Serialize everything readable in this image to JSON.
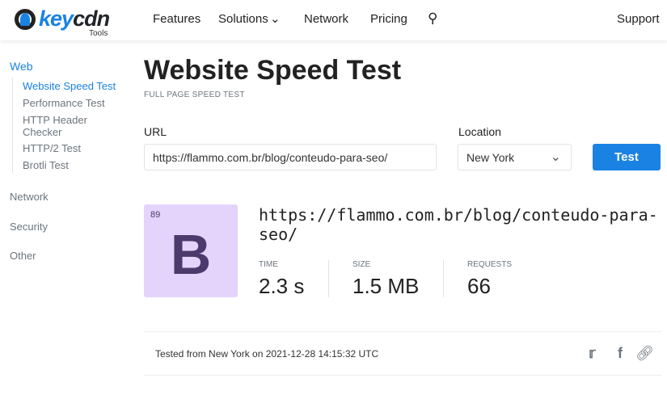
{
  "header": {
    "logo_text": "keycdn",
    "logo_sub": "Tools",
    "nav": [
      "Features",
      "Solutions",
      "Network",
      "Pricing"
    ],
    "support": "Support"
  },
  "sidebar": {
    "section": "Web",
    "items": [
      "Website Speed Test",
      "Performance Test",
      "HTTP Header Checker",
      "HTTP/2 Test",
      "Brotli Test"
    ],
    "others": [
      "Network",
      "Security",
      "Other"
    ]
  },
  "main": {
    "title": "Website Speed Test",
    "subtitle": "FULL PAGE SPEED TEST",
    "url_label": "URL",
    "url_value": "https://flammo.com.br/blog/conteudo-para-seo/",
    "location_label": "Location",
    "location_value": "New York",
    "test_button": "Test"
  },
  "result": {
    "score": "89",
    "grade": "B",
    "grade_color": "#e4d4fc",
    "url": "https://flammo.com.br/blog/conteudo-para-seo/",
    "metrics": [
      {
        "label": "TIME",
        "value": "2.3 s"
      },
      {
        "label": "SIZE",
        "value": "1.5 MB"
      },
      {
        "label": "REQUESTS",
        "value": "66"
      }
    ],
    "footer": "Tested from New York on 2021-12-28 14:15:32 UTC"
  },
  "colors": {
    "accent": "#1a82e2"
  }
}
